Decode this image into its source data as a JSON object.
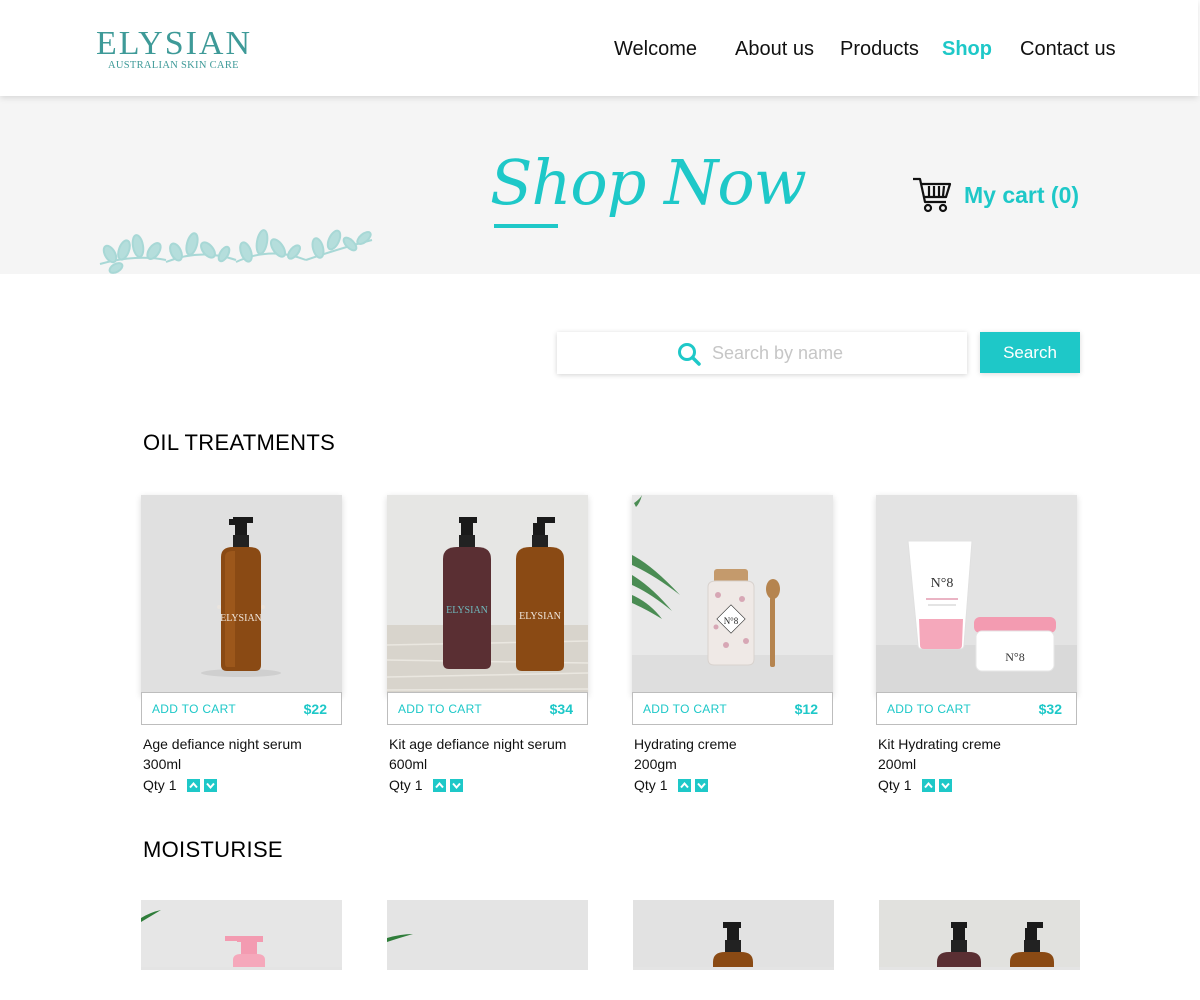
{
  "brand": {
    "name": "ELYSIAN",
    "tagline": "AUSTRALIAN SKIN CARE"
  },
  "nav": {
    "items": [
      {
        "label": "Welcome",
        "active": false
      },
      {
        "label": "About us",
        "active": false
      },
      {
        "label": "Products",
        "active": false
      },
      {
        "label": "Shop",
        "active": true
      },
      {
        "label": "Contact us",
        "active": false
      }
    ]
  },
  "hero": {
    "title": "Shop Now",
    "cart_label": "My cart (0)"
  },
  "search": {
    "placeholder": "Search by name",
    "button_label": "Search"
  },
  "sections": [
    {
      "title": "OIL TREATMENTS",
      "products": [
        {
          "add_label": "ADD TO CART",
          "price": "$22",
          "name": "Age defiance night serum",
          "size": "300ml",
          "qty_label": "Qty",
          "qty": "1",
          "bottle_label": "ELYSIAN"
        },
        {
          "add_label": "ADD TO CART",
          "price": "$34",
          "name": "Kit age defiance night serum",
          "size": "600ml",
          "qty_label": "Qty",
          "qty": "1",
          "bottle_label": "ELYSIAN"
        },
        {
          "add_label": "ADD TO CART",
          "price": "$12",
          "name": "Hydrating creme",
          "size": "200gm",
          "qty_label": "Qty",
          "qty": "1",
          "bottle_label": "N°8"
        },
        {
          "add_label": "ADD TO CART",
          "price": "$32",
          "name": "Kit Hydrating creme",
          "size": "200ml",
          "qty_label": "Qty",
          "qty": "1",
          "bottle_label": "N°8"
        }
      ]
    },
    {
      "title": "MOISTURISE",
      "products": []
    }
  ],
  "colors": {
    "accent": "#1ec8c8",
    "brand": "#3e9a98",
    "hero_bg": "#f5f5f5",
    "amber": "#8a4a14"
  },
  "icons": [
    "cart-icon",
    "search-icon",
    "arrow-up-icon",
    "arrow-down-icon",
    "leaf-decoration"
  ]
}
